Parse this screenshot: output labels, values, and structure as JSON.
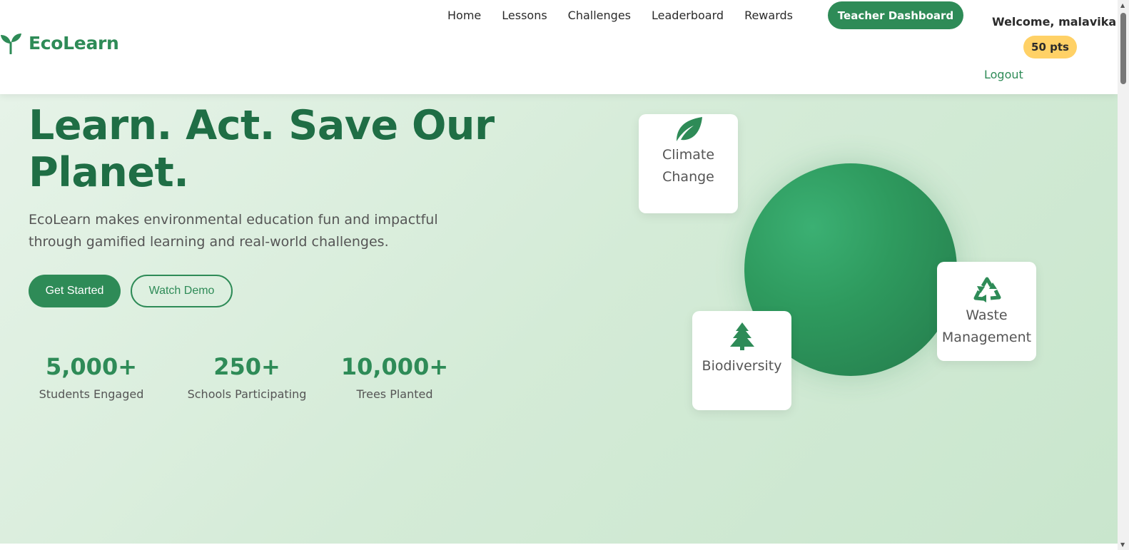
{
  "brand": {
    "name": "EcoLearn",
    "logo_icon": "sprout-icon"
  },
  "nav": {
    "items": [
      "Home",
      "Lessons",
      "Challenges",
      "Leaderboard",
      "Rewards"
    ],
    "teacher_dashboard": "Teacher Dashboard"
  },
  "user": {
    "welcome": "Welcome, malavika",
    "points": "50 pts",
    "logout": "Logout"
  },
  "hero": {
    "title_line1": "Learn. Act. Save Our",
    "title_line2": "Planet.",
    "description": "EcoLearn makes environmental education fun and impactful through gamified learning and real-world challenges.",
    "primary_cta": "Get Started",
    "secondary_cta": "Watch Demo"
  },
  "stats": [
    {
      "value": "5,000+",
      "label": "Students Engaged"
    },
    {
      "value": "250+",
      "label": "Schools Participating"
    },
    {
      "value": "10,000+",
      "label": "Trees Planted"
    }
  ],
  "topics": {
    "climate": {
      "label_line1": "Climate",
      "label_line2": "Change",
      "icon": "leaf-icon"
    },
    "biodiversity": {
      "label": "Biodiversity",
      "icon": "tree-icon"
    },
    "waste": {
      "label_line1": "Waste",
      "label_line2": "Management",
      "icon": "recycle-icon"
    }
  },
  "colors": {
    "primary": "#2e8b57",
    "dark": "#1f6e45",
    "points_badge": "#ffd166"
  }
}
